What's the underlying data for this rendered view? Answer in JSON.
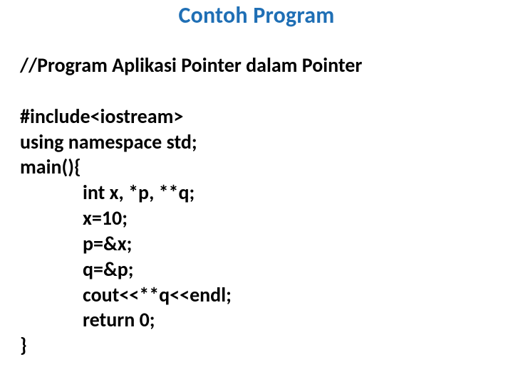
{
  "title": "Contoh Program",
  "code": {
    "comment": "//Program Aplikasi Pointer dalam Pointer",
    "lines": [
      "#include<iostream>",
      "using namespace std;",
      "main(){"
    ],
    "indented": [
      "int x, *p, **q;",
      "x=10;",
      "p=&x;",
      "q=&p;",
      "cout<<**q<<endl;",
      "return 0;"
    ],
    "close": "}"
  }
}
